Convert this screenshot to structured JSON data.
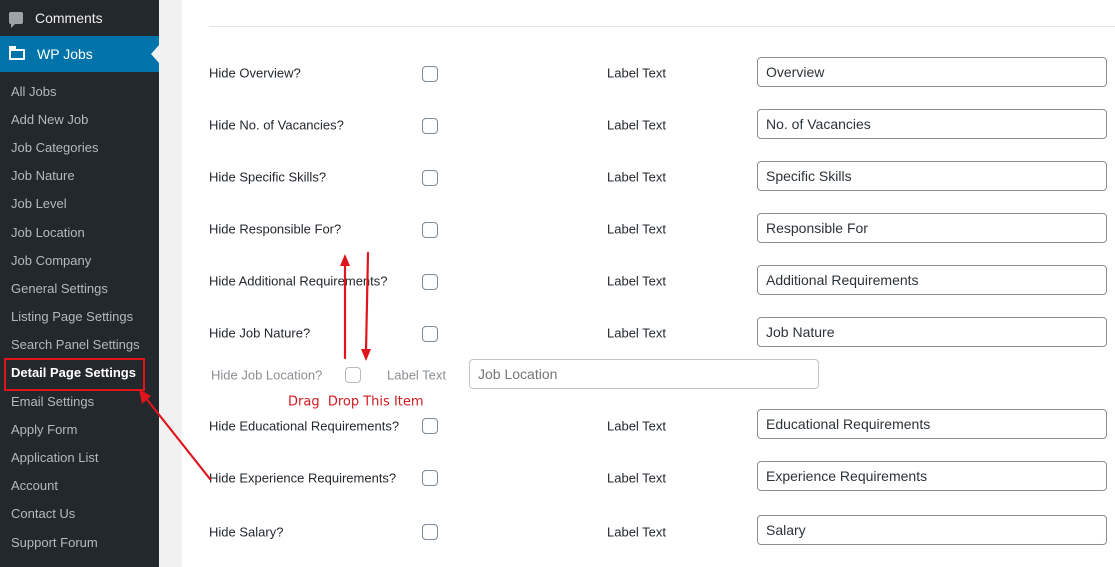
{
  "sidebar": {
    "comments_label": "Comments",
    "plugin_label": "WP Jobs",
    "items": [
      {
        "label": "All Jobs"
      },
      {
        "label": "Add New Job"
      },
      {
        "label": "Job Categories"
      },
      {
        "label": "Job Nature"
      },
      {
        "label": "Job Level"
      },
      {
        "label": "Job Location"
      },
      {
        "label": "Job Company"
      },
      {
        "label": "General Settings"
      },
      {
        "label": "Listing Page Settings"
      },
      {
        "label": "Search Panel Settings"
      },
      {
        "label": "Detail Page Settings"
      },
      {
        "label": "Email Settings"
      },
      {
        "label": "Apply Form"
      },
      {
        "label": "Application List"
      },
      {
        "label": "Account"
      },
      {
        "label": "Contact Us"
      },
      {
        "label": "Support Forum"
      }
    ],
    "current_index": 10
  },
  "settings": {
    "label_text": "Label Text",
    "rows": [
      {
        "hide_label": "Hide Overview?",
        "value": "Overview",
        "checked": false
      },
      {
        "hide_label": "Hide No. of Vacancies?",
        "value": "No. of Vacancies",
        "checked": false
      },
      {
        "hide_label": "Hide Specific Skills?",
        "value": "Specific Skills",
        "checked": false
      },
      {
        "hide_label": "Hide Responsible For?",
        "value": "Responsible For",
        "checked": false
      },
      {
        "hide_label": "Hide Additional Requirements?",
        "value": "Additional Requirements",
        "checked": false
      },
      {
        "hide_label": "Hide Job Nature?",
        "value": "Job Nature",
        "checked": false
      },
      {
        "hide_label": "Hide Educational Requirements?",
        "value": "Educational Requirements",
        "checked": false
      },
      {
        "hide_label": "Hide Experience Requirements?",
        "value": "Experience Requirements",
        "checked": false
      },
      {
        "hide_label": "Hide Salary?",
        "value": "Salary",
        "checked": false
      }
    ],
    "dragging_row": {
      "hide_label": "Hide Job Location?",
      "label_text": "Label Text",
      "placeholder": "Job Location",
      "checked": false
    }
  },
  "annotation": {
    "note": "Drag  Drop This Item",
    "color": "#e0141b"
  },
  "colors": {
    "sidebar_bg": "#23282d",
    "accent": "#0073aa",
    "highlight": "#e0141b"
  }
}
